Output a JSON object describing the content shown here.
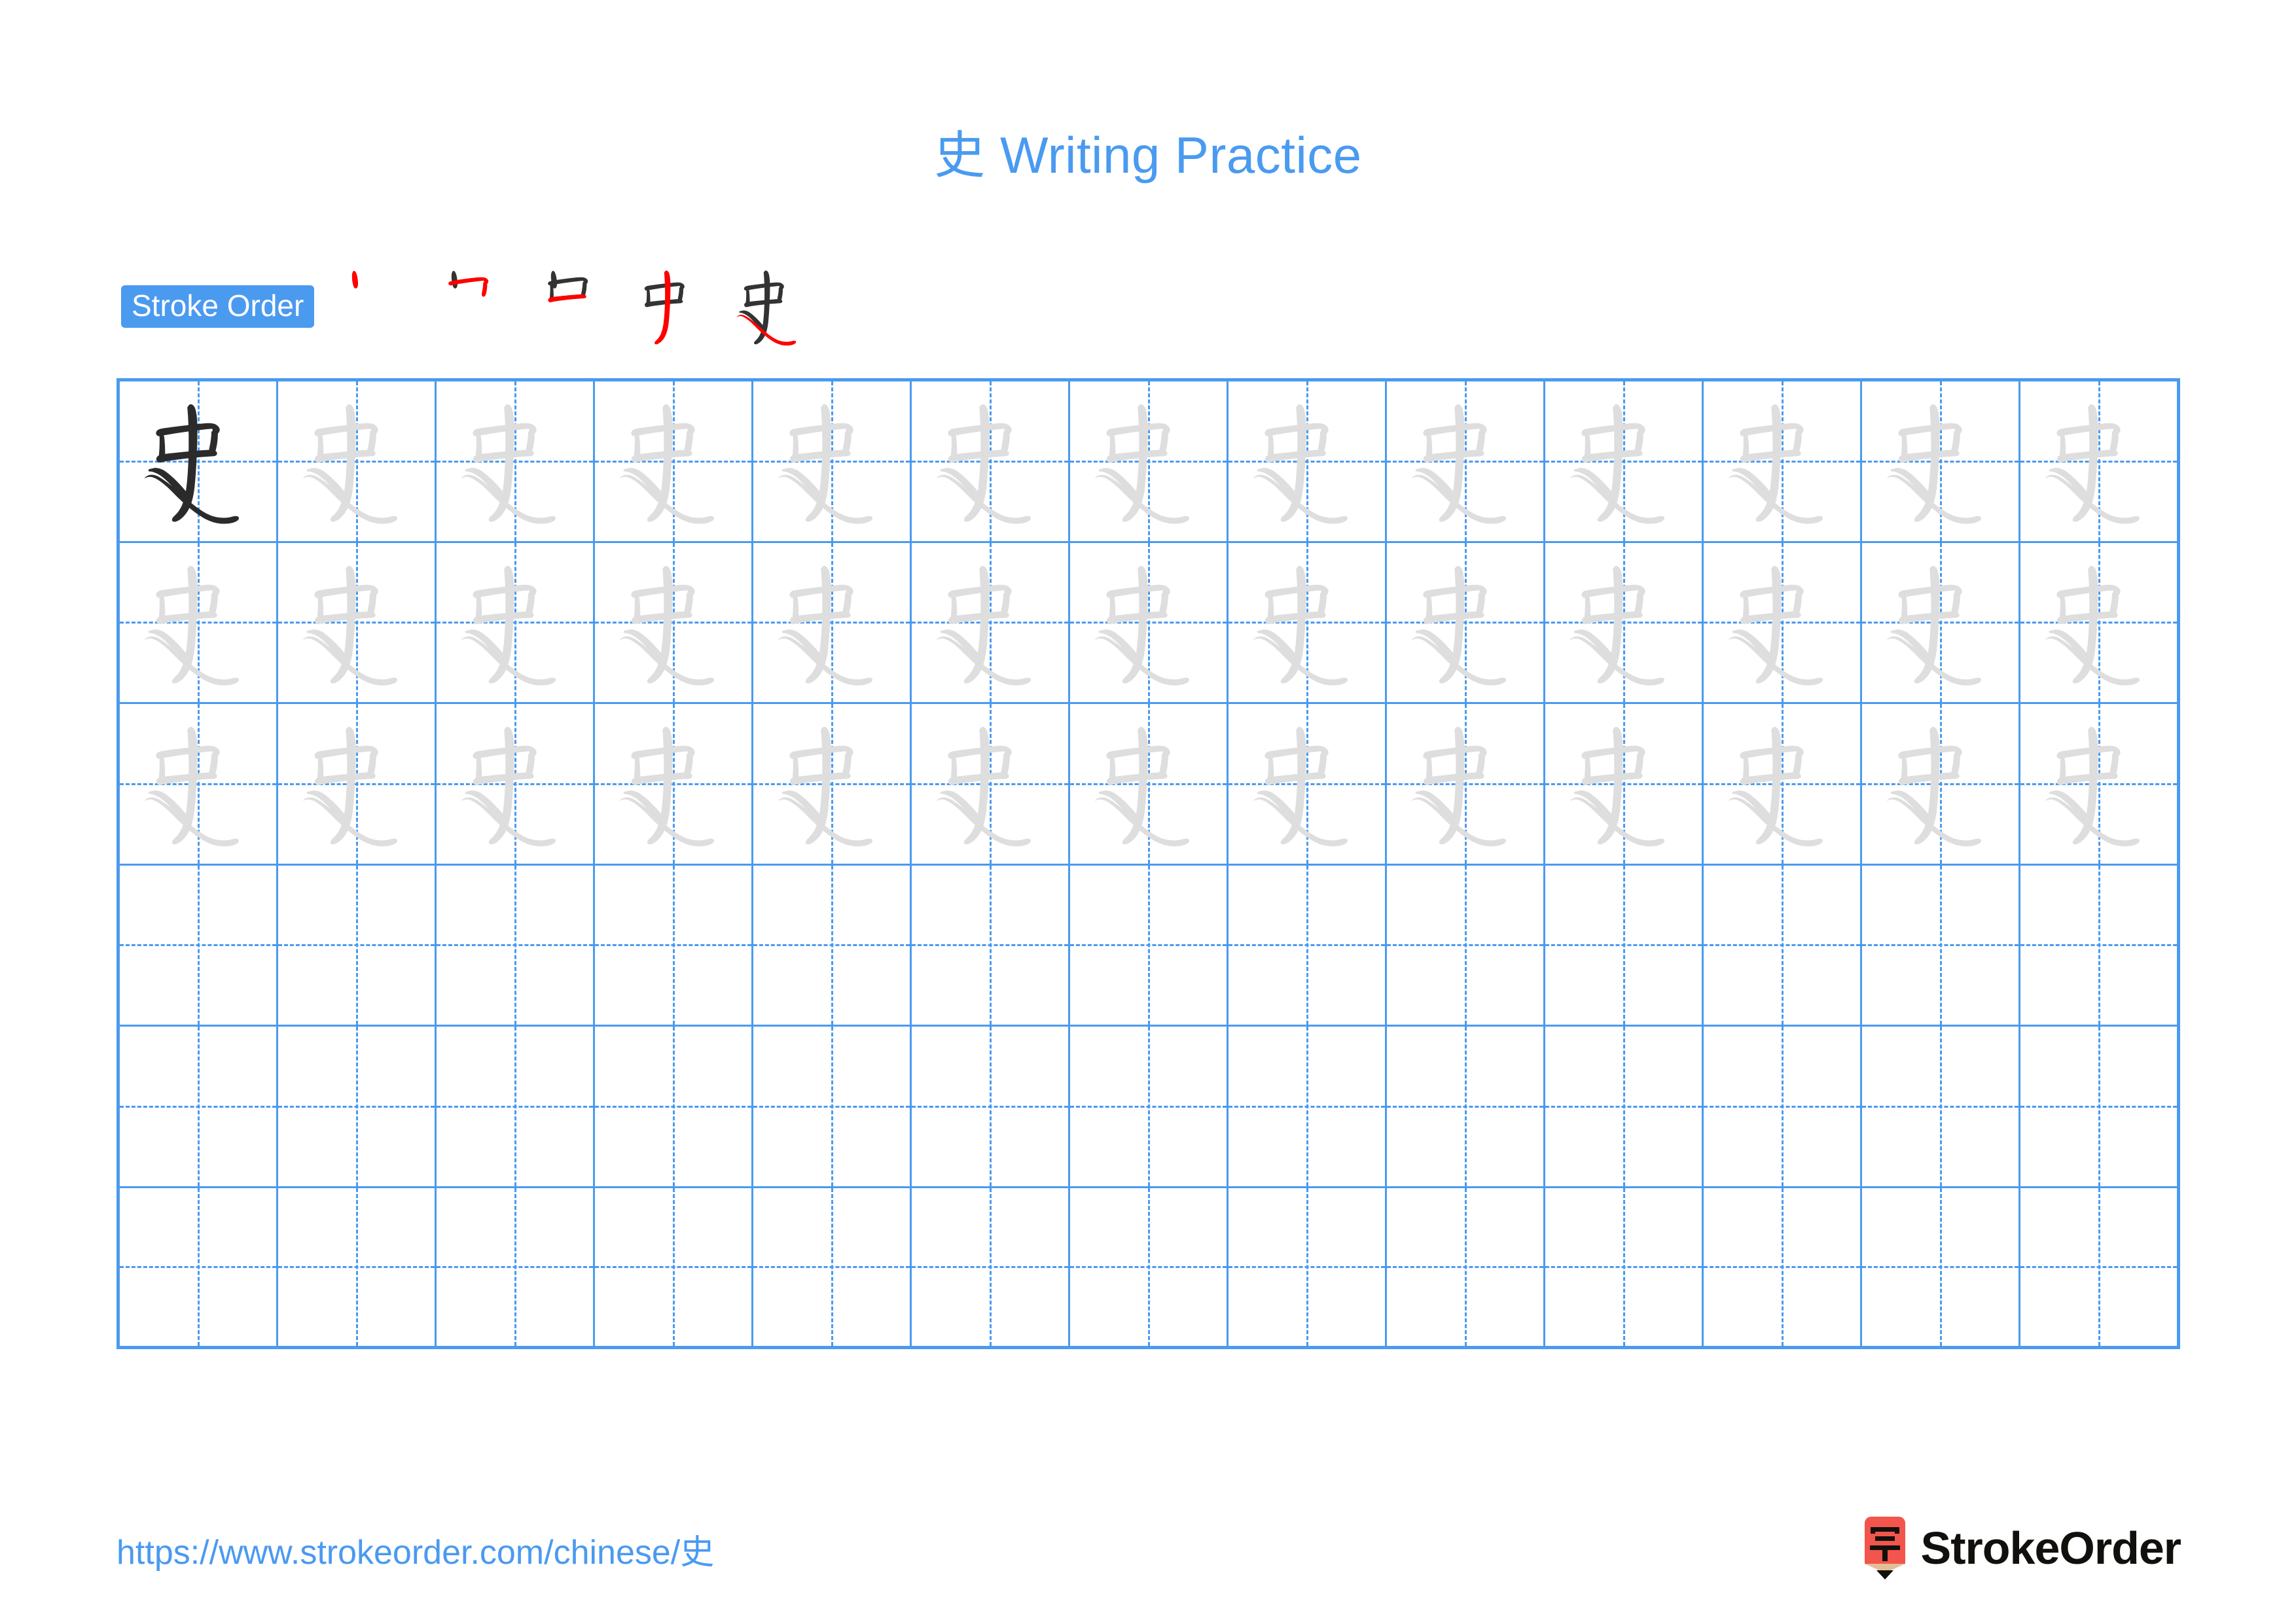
{
  "page": {
    "character": "史",
    "title": "史 Writing Practice",
    "title_prefix": "史",
    "title_suffix": " Writing Practice",
    "background_color": "#ffffff",
    "accent_color": "#4a9af0",
    "stroke_new_color": "#ff0000",
    "stroke_done_color": "#333333",
    "trace_color": "#dedede",
    "model_color": "#2b2b2b"
  },
  "stroke_order": {
    "badge_label": "Stroke Order",
    "stroke_count": 5,
    "steps": [
      {
        "index": 1,
        "name": "stroke-step-1",
        "new_stroke": "dot",
        "strokes_shown": 1
      },
      {
        "index": 2,
        "name": "stroke-step-2",
        "new_stroke": "horizontal-turn-vertical",
        "strokes_shown": 2
      },
      {
        "index": 3,
        "name": "stroke-step-3",
        "new_stroke": "horizontal-close",
        "strokes_shown": 3
      },
      {
        "index": 4,
        "name": "stroke-step-4",
        "new_stroke": "vertical-through",
        "strokes_shown": 4
      },
      {
        "index": 5,
        "name": "stroke-step-5",
        "new_stroke": "right-falling",
        "strokes_shown": 5
      }
    ]
  },
  "grid": {
    "columns": 13,
    "rows": 6,
    "row_types": [
      "model-and-trace",
      "trace",
      "trace",
      "blank",
      "blank",
      "blank"
    ],
    "model_cell": {
      "row": 1,
      "column": 1
    }
  },
  "footer": {
    "url": "https://www.strokeorder.com/chinese/史",
    "brand_name": "StrokeOrder",
    "logo_char": "字",
    "logo_body_color": "#f2554b",
    "logo_wood_color": "#e3bf96",
    "logo_tip_color": "#12100d"
  }
}
